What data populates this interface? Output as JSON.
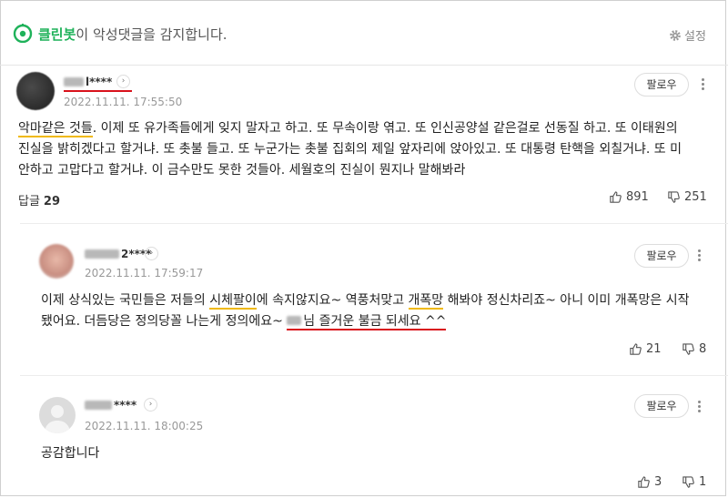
{
  "banner": {
    "brand": "클린봇",
    "message": "이 악성댓글을 감지합니다.",
    "settings_label": "설정"
  },
  "comments": [
    {
      "nick_visible": "l****",
      "date": "2022.11.11. 17:55:50",
      "follow_label": "팔로우",
      "text_parts": {
        "p1": "악마같은 것들",
        "p2": ". 이제 또 유가족들에게 잊지 말자고 하고. 또 무속이랑 엮고. 또 인신공양설 같은걸로 선동질 하고. 또 이태원의 진실을 밝히겠다고 할거냐. 또 촛불 들고. 또 누군가는 촛불 집회의 제일 앞자리에 앉아있고. 또 대통령 탄핵을 외칠거냐. 또 미안하고 고맙다고 할거냐. 이 금수만도 못한 것들아. 세월호의 진실이 뭔지나 말해봐라"
      },
      "reply_label": "답글",
      "reply_count": "29",
      "likes": "891",
      "dislikes": "251"
    },
    {
      "nick_visible": "2****",
      "date": "2022.11.11. 17:59:17",
      "follow_label": "팔로우",
      "text_parts": {
        "p1": "이제 상식있는 국민들은 저들의 ",
        "p2": "시체팔이",
        "p3": "에 속지않지요~ 역풍처맞고 ",
        "p4": "개폭망",
        "p5": " 해봐야 정신차리죠~ 아니 이미 개폭망은 시작됐어요. 더듬당은 정의당꼴 나는게 정의에요~ ",
        "p6": "님 즐거운 불금 되세요 ^^"
      },
      "likes": "21",
      "dislikes": "8"
    },
    {
      "nick_visible": "****",
      "date": "2022.11.11. 18:00:25",
      "follow_label": "팔로우",
      "text": "공감합니다",
      "likes": "3",
      "dislikes": "1"
    }
  ],
  "icons": {
    "bot": "cleanbot-icon",
    "settings": "gear-icon",
    "like": "thumbs-up-icon",
    "dislike": "thumbs-down-icon",
    "more": "kebab-menu-icon",
    "profile": "chevron-right-icon"
  },
  "colors": {
    "brand": "#1fb25a",
    "underline_yellow": "#f0b90b",
    "underline_red": "#d9121c"
  }
}
